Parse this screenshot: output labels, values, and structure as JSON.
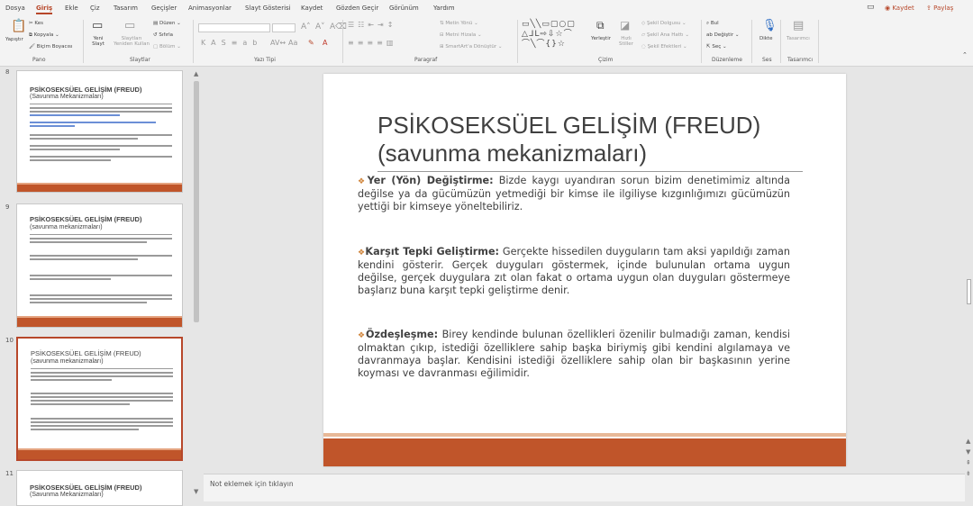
{
  "menu": {
    "tabs": [
      "Dosya",
      "Giriş",
      "Ekle",
      "Çiz",
      "Tasarım",
      "Geçişler",
      "Animasyonlar",
      "Slayt Gösterisi",
      "Kaydet",
      "Gözden Geçir",
      "Görünüm",
      "Yardım"
    ],
    "active_index": 1,
    "save_label": "Kaydet",
    "share_label": "Paylaş"
  },
  "ribbon": {
    "groups": [
      "Pano",
      "Slaytlar",
      "Yazı Tipi",
      "Paragraf",
      "Çizim",
      "Düzenleme",
      "Ses",
      "Tasarımcı"
    ],
    "clipboard": {
      "paste": "Yapıştır",
      "cut": "Kes",
      "copy": "Kopyala",
      "format_painter": "Biçim Boyacısı"
    },
    "slides": {
      "new_slide": "Yeni Slayt",
      "reuse": "Slaytları Yeniden Kullan",
      "layout": "Düzen",
      "reset": "Sıfırla",
      "section": "Bölüm"
    },
    "paragraph": {
      "text_direction": "Metin Yönü",
      "align_text": "Metni Hizala",
      "smartart": "SmartArt'a Dönüştür"
    },
    "drawing": {
      "arrange": "Yerleştir",
      "quick_styles": "Hızlı Stiller",
      "fill": "Şekil Dolgusu",
      "outline": "Şekil Ana Hattı",
      "effects": "Şekil Efektleri"
    },
    "editing": {
      "find": "Bul",
      "replace": "Değiştir",
      "select": "Seç"
    },
    "voice": {
      "dictate": "Dikte"
    },
    "designer": {
      "label": "Tasarımcı"
    }
  },
  "thumbnails": [
    {
      "number": "8",
      "title": "PSİKOSEKSÜEL GELİŞİM (FREUD)",
      "subtitle": "(Savunma Mekanizmaları)"
    },
    {
      "number": "9",
      "title": "PSİKOSEKSÜEL GELİŞİM (FREUD)",
      "subtitle": "(savunma mekanizmaları)"
    },
    {
      "number": "10",
      "title": "PSİKOSEKSÜEL GELİŞİM (FREUD)",
      "subtitle": "(savunma mekanizmaları)"
    },
    {
      "number": "11",
      "title": "PSİKOSEKSÜEL GELİŞİM (FREUD)",
      "subtitle": "(Savunma Mekanizmaları)"
    }
  ],
  "slide": {
    "title_line1": "PSİKOSEKSÜEL GELİŞİM (FREUD)",
    "title_line2": "(savunma mekanizmaları)",
    "bullets": [
      {
        "term": "Yer (Yön) Değiştirme:",
        "text": " Bizde kaygı uyandıran sorun bizim denetimimiz altında değilse ya da gücümüzün yetmediği bir kimse ile ilgiliyse kızgınlığımızı gücümüzün yettiği bir kimseye yöneltebiliriz."
      },
      {
        "term": "Karşıt Tepki Geliştirme:",
        "text": " Gerçekte hissedilen duyguların tam aksi yapıldığı zaman kendini gösterir. Gerçek duyguları göstermek, içinde bulunulan ortama uygun değilse, gerçek duygulara zıt olan fakat o ortama uygun olan duyguları göstermeye başlarız buna karşıt tepki geliştirme denir."
      },
      {
        "term": "Özdeşleşme:",
        "text": " Birey kendinde bulunan özellikleri özenilir bulmadığı zaman, kendisi olmaktan çıkıp, istediği özelliklere sahip başka biriymiş gibi kendini algılamaya ve davranmaya başlar. Kendisini istediği özelliklere sahip olan bir başkasının yerine koyması ve davranması eğilimidir."
      }
    ]
  },
  "notes": {
    "placeholder": "Not eklemek için tıklayın"
  },
  "colors": {
    "accent": "#b7472a",
    "slide_bar": "#c0552a",
    "bullet": "#d0843a"
  }
}
